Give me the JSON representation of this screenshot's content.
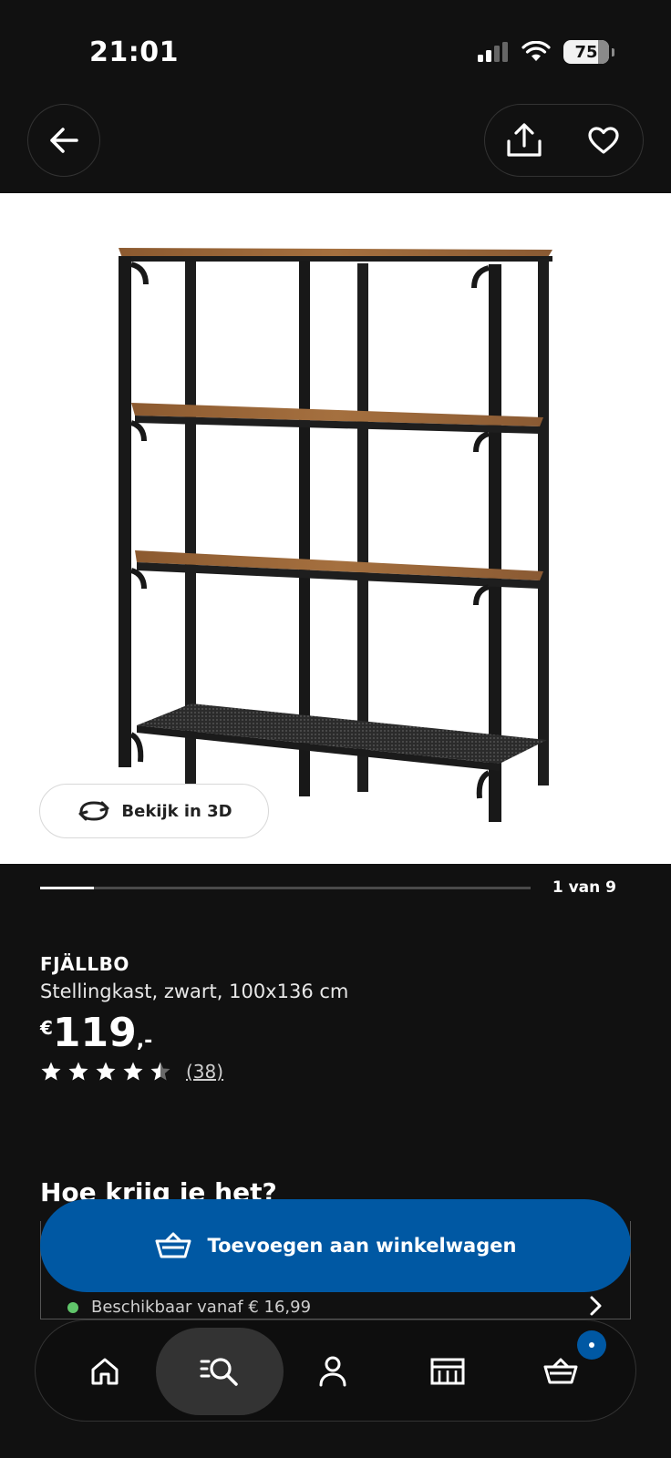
{
  "status_bar": {
    "time": "21:01",
    "battery": "75"
  },
  "header": {
    "back_icon": "arrow-left-icon",
    "share_icon": "share-icon",
    "favorite_icon": "heart-icon"
  },
  "hero": {
    "view3d_label": "Bekijk in 3D",
    "view3d_icon": "rotate-3d-icon"
  },
  "gallery": {
    "position_label": "1 van 9",
    "progress": 0.11
  },
  "product": {
    "name": "FJÄLLBO",
    "description": "Stellingkast, zwart, 100x136 cm",
    "price_currency": "€",
    "price_amount": "119",
    "price_suffix": ",-",
    "rating": 4.5,
    "review_count": "(38)"
  },
  "delivery": {
    "title": "Hoe krijg je het?",
    "availability": "Beschikbaar vanaf € 16,99",
    "status_color": "#60c56a"
  },
  "cta": {
    "label": "Toevoegen aan winkelwagen",
    "color": "#0058a3",
    "icon": "basket-icon"
  },
  "nav": {
    "items": [
      {
        "name": "home",
        "icon": "home-icon"
      },
      {
        "name": "search",
        "icon": "search-icon",
        "active": true
      },
      {
        "name": "account",
        "icon": "person-icon"
      },
      {
        "name": "stores",
        "icon": "store-icon"
      },
      {
        "name": "cart",
        "icon": "basket-icon"
      }
    ]
  }
}
